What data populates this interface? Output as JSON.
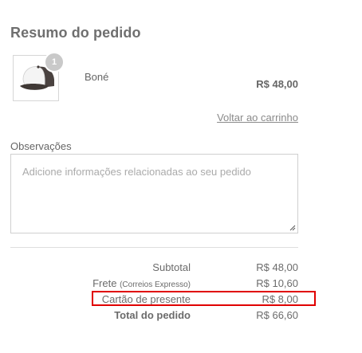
{
  "summary": {
    "title": "Resumo do pedido",
    "item": {
      "name": "Boné",
      "quantity": "1",
      "price": "R$ 48,00",
      "image_icon": "cap-icon"
    },
    "back_link": "Voltar ao carrinho"
  },
  "observations": {
    "label": "Observações",
    "placeholder": "Adicione informações relacionadas ao seu pedido",
    "value": ""
  },
  "totals": {
    "subtotal_label": "Subtotal",
    "subtotal_value": "R$ 48,00",
    "shipping_label": "Frete",
    "shipping_method": "(Correios Expresso)",
    "shipping_value": "R$ 10,60",
    "gift_card_label": "Cartão de presente",
    "gift_card_value": "R$ 8,00",
    "total_label": "Total do pedido",
    "total_value": "R$ 66,60"
  },
  "colors": {
    "highlight": "#e00000",
    "text": "#6b6b6b"
  }
}
